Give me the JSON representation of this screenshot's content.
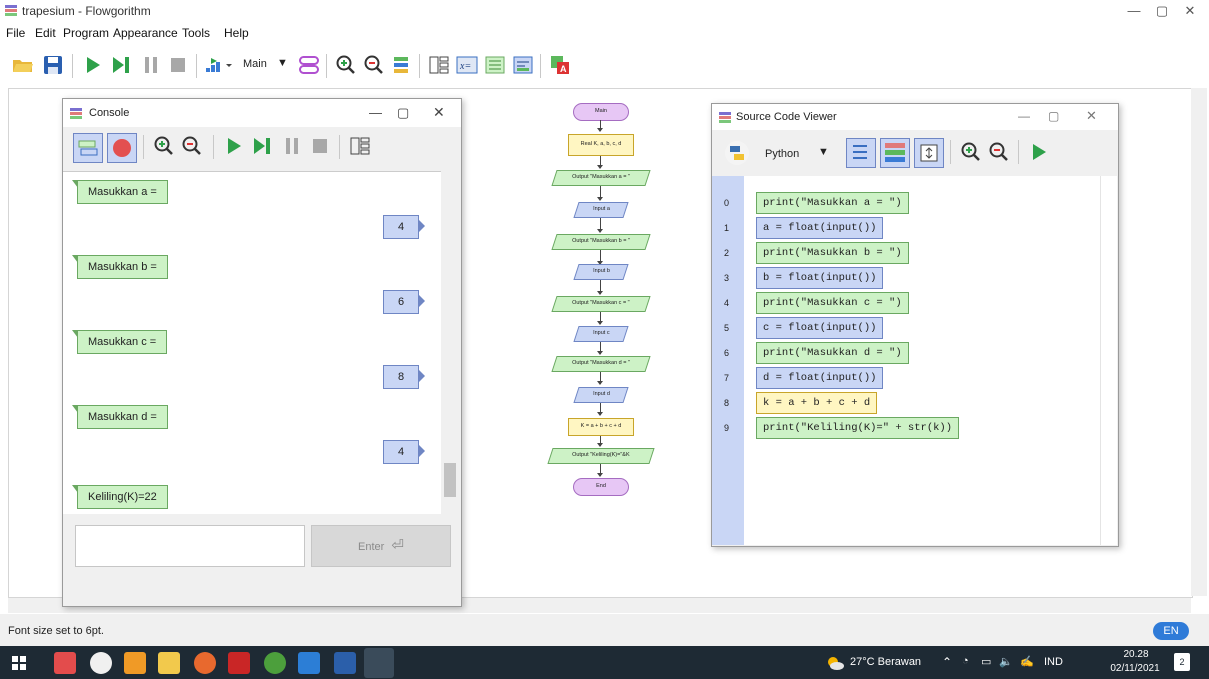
{
  "window": {
    "title": "trapesium - Flowgorithm"
  },
  "menu": [
    "File",
    "Edit",
    "Program",
    "Appearance",
    "Tools",
    "Help"
  ],
  "toolbar": {
    "function_select": "Main"
  },
  "console": {
    "title": "Console",
    "messages": [
      {
        "type": "out",
        "text": "Masukkan a ="
      },
      {
        "type": "in",
        "text": "4"
      },
      {
        "type": "out",
        "text": "Masukkan b ="
      },
      {
        "type": "in",
        "text": "6"
      },
      {
        "type": "out",
        "text": "Masukkan c ="
      },
      {
        "type": "in",
        "text": "8"
      },
      {
        "type": "out",
        "text": "Masukkan d ="
      },
      {
        "type": "in",
        "text": "4"
      },
      {
        "type": "out",
        "text": "Keliling(K)=22"
      }
    ],
    "input_placeholder": "",
    "enter_label": "Enter"
  },
  "flowchart": {
    "nodes": [
      {
        "kind": "oval",
        "text": "Main"
      },
      {
        "kind": "rect",
        "text": "Real K, a, b, c, d"
      },
      {
        "kind": "out",
        "text": "Output \"Masukkan a = \""
      },
      {
        "kind": "in",
        "text": "Input a"
      },
      {
        "kind": "out",
        "text": "Output \"Masukkan b = \""
      },
      {
        "kind": "in",
        "text": "Input b"
      },
      {
        "kind": "out",
        "text": "Output \"Masukkan c = \""
      },
      {
        "kind": "in",
        "text": "Input c"
      },
      {
        "kind": "out",
        "text": "Output \"Masukkan d = \""
      },
      {
        "kind": "in",
        "text": "Input d"
      },
      {
        "kind": "rect",
        "text": "K = a + b + c + d"
      },
      {
        "kind": "out",
        "text": "Output \"Keliling(K)=\"&K"
      },
      {
        "kind": "oval",
        "text": "End"
      }
    ]
  },
  "source_viewer": {
    "title": "Source Code Viewer",
    "language": "Python",
    "lines": [
      {
        "n": "0",
        "type": "out",
        "code": "print(\"Masukkan a = \")"
      },
      {
        "n": "1",
        "type": "in",
        "code": "a = float(input())"
      },
      {
        "n": "2",
        "type": "out",
        "code": "print(\"Masukkan b = \")"
      },
      {
        "n": "3",
        "type": "in",
        "code": "b = float(input())"
      },
      {
        "n": "4",
        "type": "out",
        "code": "print(\"Masukkan c = \")"
      },
      {
        "n": "5",
        "type": "in",
        "code": "c = float(input())"
      },
      {
        "n": "6",
        "type": "out",
        "code": "print(\"Masukkan d = \")"
      },
      {
        "n": "7",
        "type": "in",
        "code": "d = float(input())"
      },
      {
        "n": "8",
        "type": "asg",
        "code": "k = a + b + c + d"
      },
      {
        "n": "9",
        "type": "out",
        "code": "print(\"Keliling(K)=\" + str(k))"
      }
    ]
  },
  "status": {
    "text": "Font size set to 6pt.",
    "lang_badge": "EN"
  },
  "taskbar": {
    "weather": "27°C  Berawan",
    "lang": "IND",
    "time": "20.28",
    "date": "02/11/2021",
    "notif_count": "2"
  },
  "colors": {
    "output": "#cdf2c6",
    "input": "#c9d6f5",
    "assign": "#fff6c2",
    "terminal": "#e7c7f5"
  }
}
